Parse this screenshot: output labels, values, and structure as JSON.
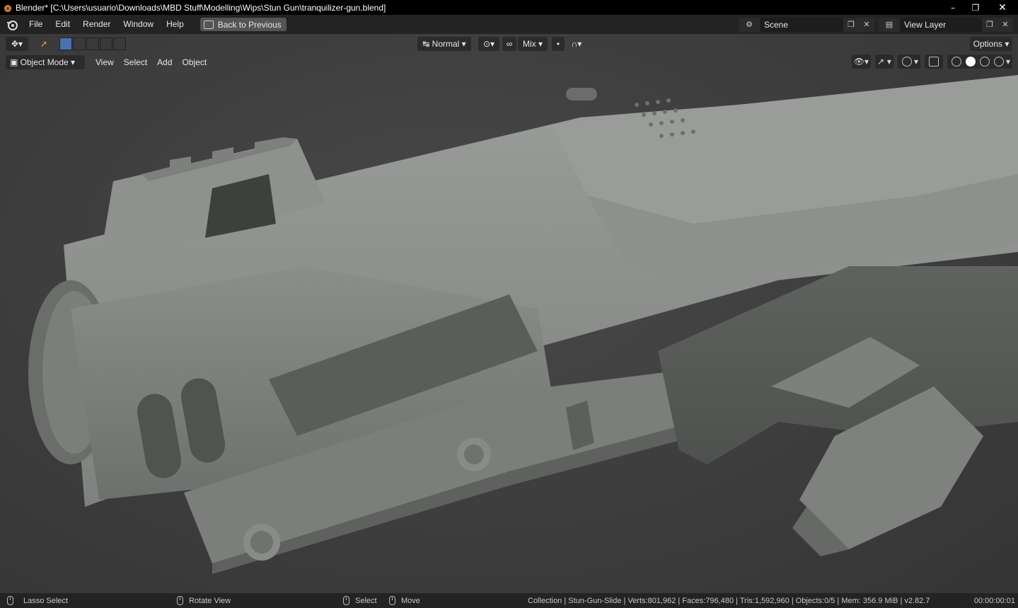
{
  "window": {
    "title": "Blender* [C:\\Users\\usuario\\Downloads\\MBD Stuff\\Modelling\\Wips\\Stun Gun\\tranquilizer-gun.blend]",
    "minimize": "–",
    "maximize": "❐",
    "close": "✕"
  },
  "menubar": {
    "items": [
      "File",
      "Edit",
      "Render",
      "Window",
      "Help"
    ],
    "back_button": "Back to Previous",
    "scene": "Scene",
    "view_layer": "View Layer"
  },
  "viewport_header": {
    "orientation": "Normal",
    "blend": "Mix",
    "options": "Options",
    "mode": "Object Mode",
    "menu": [
      "View",
      "Select",
      "Add",
      "Object"
    ]
  },
  "statusbar": {
    "lasso": "Lasso Select",
    "rotate": "Rotate View",
    "select": "Select",
    "move": "Move",
    "stats": "Collection | Stun-Gun-Slide | Verts:801,962 | Faces:796,480 | Tris:1,592,960 | Objects:0/5 | Mem: 356.9 MiB | v2.82.7",
    "time": "00:00:00:01"
  },
  "colors": {
    "accent": "#4772b3",
    "viewport_bg": "#404040",
    "model": "#8c8f8c"
  }
}
